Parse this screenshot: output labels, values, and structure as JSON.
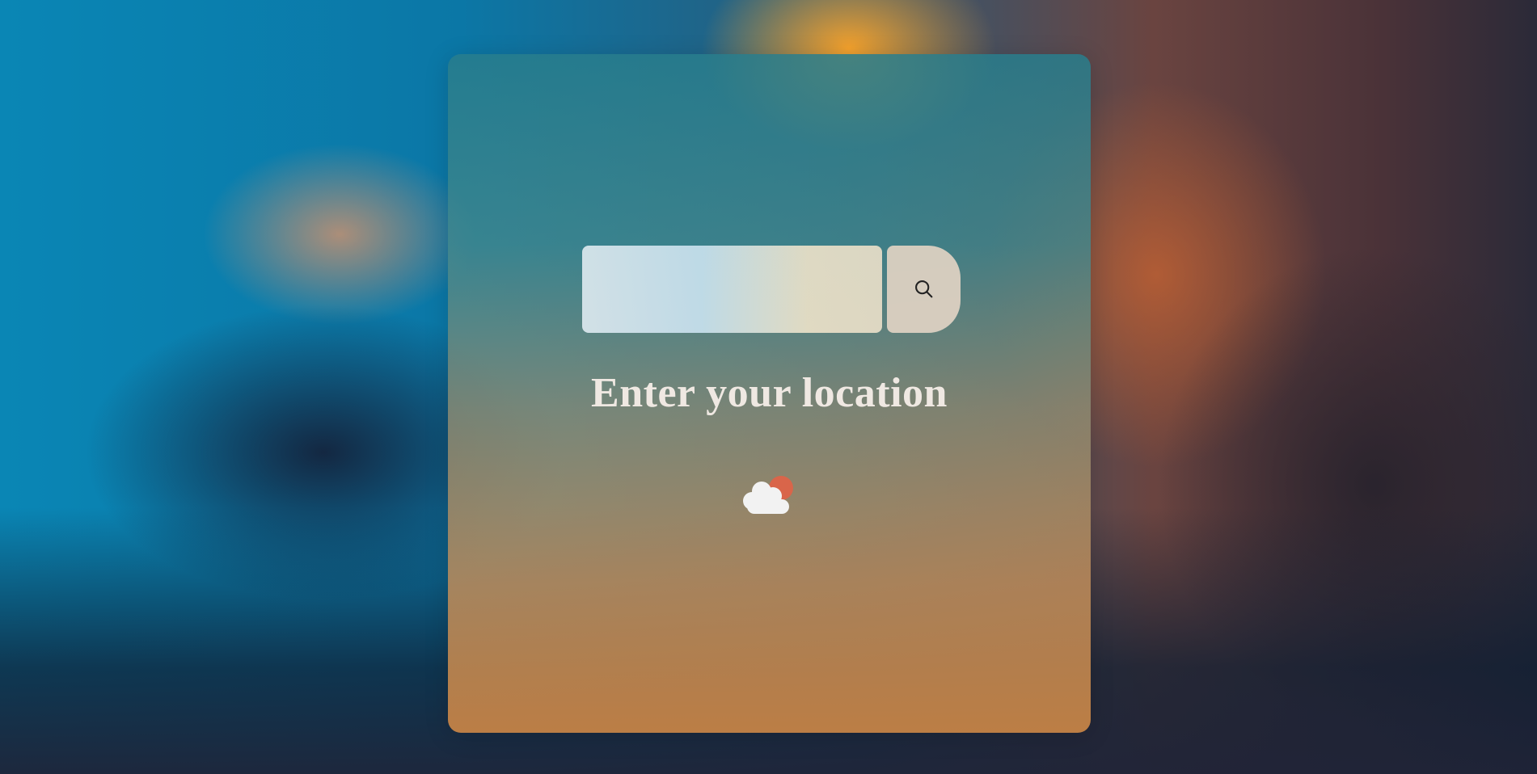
{
  "search": {
    "placeholder": "",
    "value": "",
    "button_icon": "search-icon"
  },
  "main": {
    "prompt": "Enter your location",
    "status_icon": "partly-cloudy-icon"
  },
  "colors": {
    "title_text": "#efe8e2",
    "sun": "#d9654a",
    "cloud": "#f2f2f2"
  }
}
